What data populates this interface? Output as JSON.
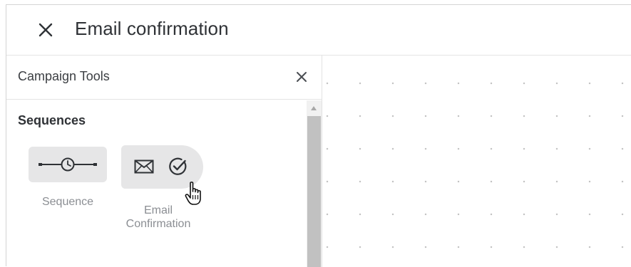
{
  "header": {
    "close_icon": "close-icon",
    "title": "Email confirmation"
  },
  "panel": {
    "title": "Campaign Tools",
    "close_icon": "close-icon",
    "section_title": "Sequences",
    "tools": [
      {
        "label": "Sequence",
        "icon": "sequence-timer-icon"
      },
      {
        "label": "Email Confirmation",
        "label_lines": [
          "Email",
          "Confirmation"
        ],
        "icons": [
          "envelope-icon",
          "check-circle-icon"
        ],
        "hovered": true
      }
    ]
  },
  "cursor": {
    "icon": "hand-pointer-icon"
  },
  "colors": {
    "tile_bg": "#e6e6e7",
    "text_dark": "#2f3236",
    "text_muted": "#8b8e93",
    "grid_dot": "#c4c4c4"
  }
}
